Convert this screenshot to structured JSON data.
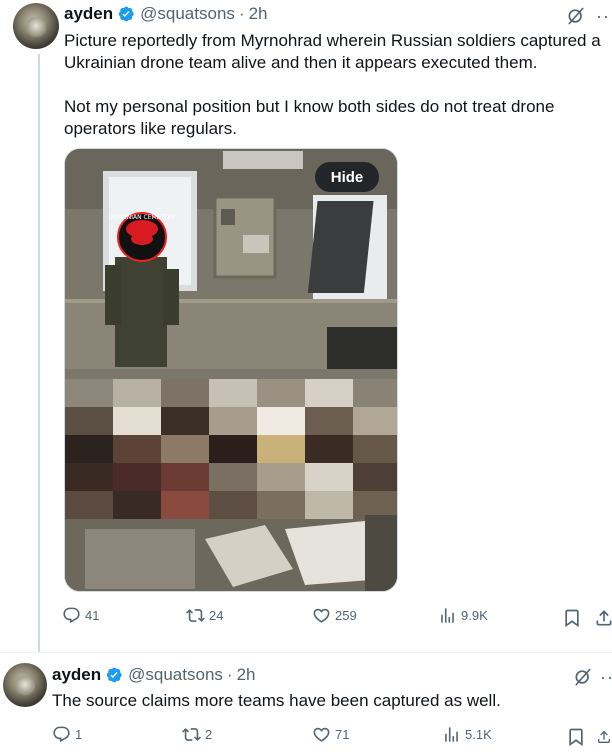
{
  "tweets": [
    {
      "author": {
        "display_name": "ayden",
        "handle": "@squatsons",
        "time": "2h",
        "verified": true
      },
      "text": [
        "Picture reportedly from Myrnohrad wherein Russian soldiers captured a Ukrainian drone team alive and then it appears executed them.",
        "Not my personal position but I know both sides do not treat drone operators like regulars."
      ],
      "media": {
        "hide_label": "Hide",
        "overlay_text": "UKRAINIAN CEMETERY"
      },
      "stats": {
        "replies": "41",
        "reposts": "24",
        "likes": "259",
        "views": "9.9K"
      }
    },
    {
      "author": {
        "display_name": "ayden",
        "handle": "@squatsons",
        "time": "2h",
        "verified": true
      },
      "text": [
        "The source claims more teams have been captured as well."
      ],
      "stats": {
        "replies": "1",
        "reposts": "2",
        "likes": "71",
        "views": "5.1K"
      }
    }
  ],
  "colors": {
    "verified": "#1d9bf0",
    "text": "#0f1419",
    "secondary": "#536471",
    "thread_line": "#cfd9de"
  },
  "icons": [
    "verified-badge-icon",
    "grok-icon",
    "more-icon",
    "reply-icon",
    "repost-icon",
    "like-icon",
    "views-icon",
    "bookmark-icon",
    "share-icon"
  ]
}
